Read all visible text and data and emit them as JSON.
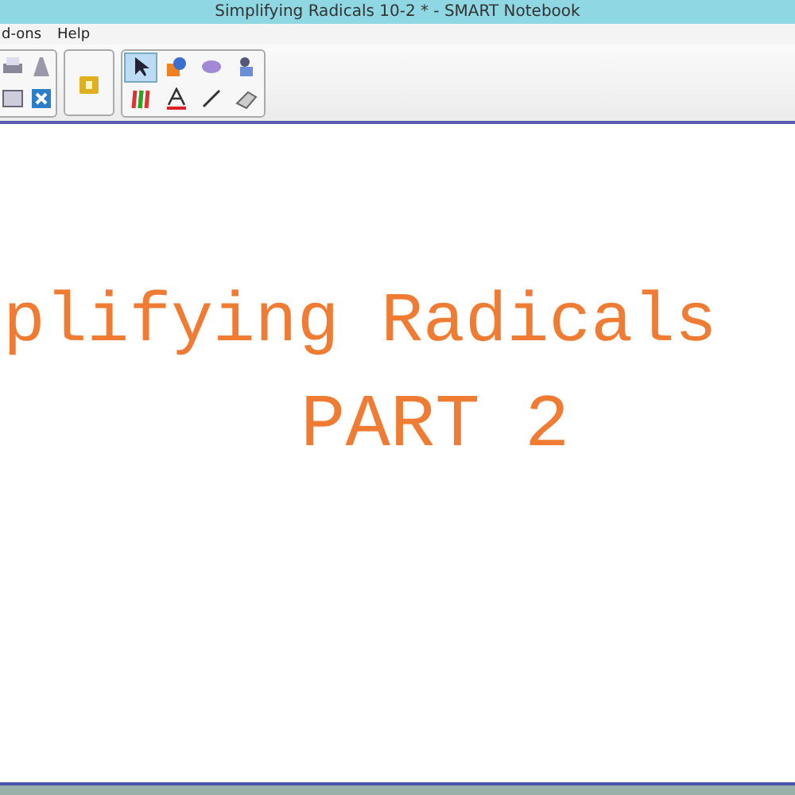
{
  "window": {
    "title": "Simplifying Radicals 10-2 * - SMART Notebook"
  },
  "menu": [
    "d-ons",
    "Help"
  ],
  "toolbar": {
    "left_tools": [
      {
        "kind": "print"
      },
      {
        "kind": "text-fill"
      },
      {
        "kind": "table"
      },
      {
        "kind": "close-box"
      }
    ],
    "tools": [
      {
        "kind": "pointer",
        "selected": true
      },
      {
        "kind": "shapes",
        "selected": false
      },
      {
        "kind": "eraser-shape",
        "selected": false
      },
      {
        "kind": "fill",
        "selected": false
      },
      {
        "kind": "pens",
        "selected": false
      },
      {
        "kind": "text",
        "selected": false
      },
      {
        "kind": "line",
        "selected": false
      },
      {
        "kind": "eraser",
        "selected": false
      }
    ]
  },
  "page": {
    "title": "plifying Radicals",
    "subtitle": "PART 2"
  }
}
